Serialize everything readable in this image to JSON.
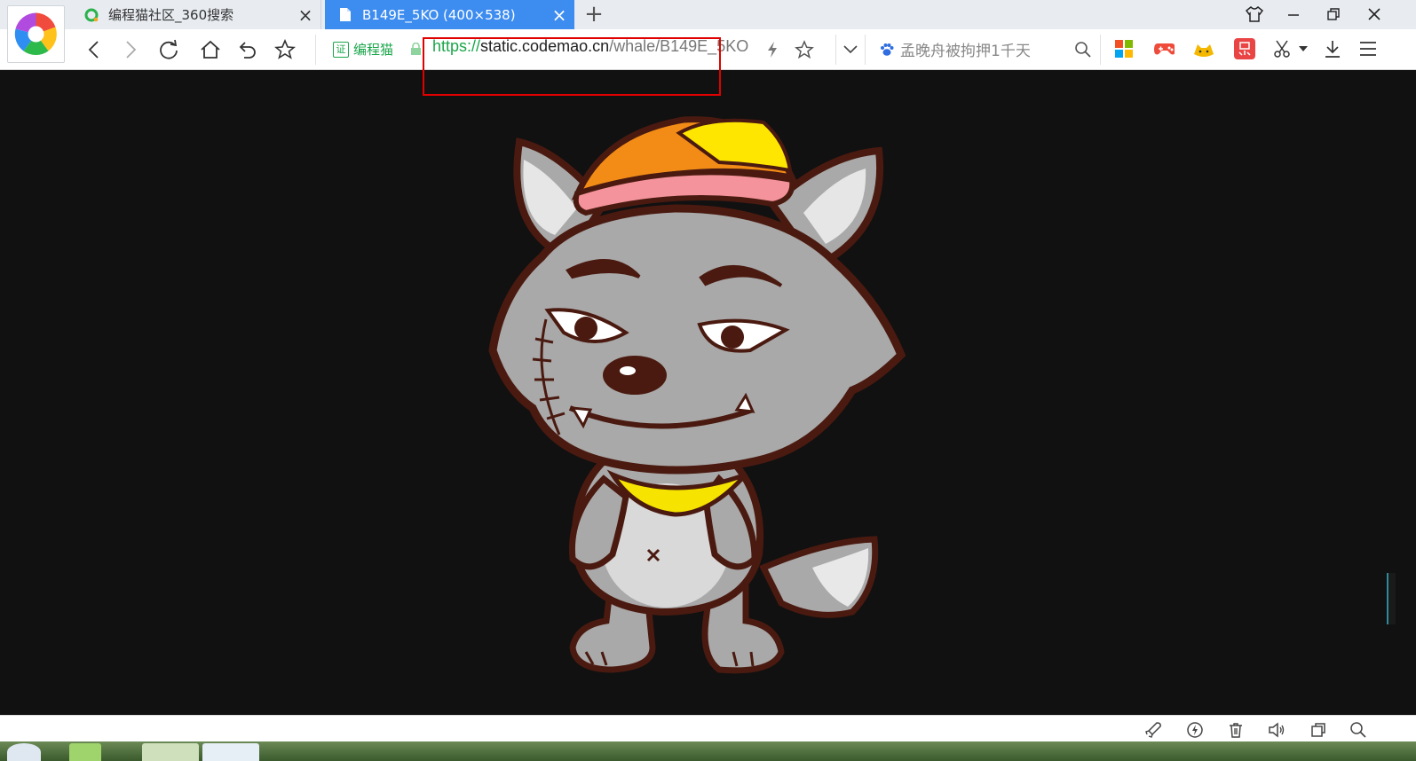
{
  "tabs": [
    {
      "title": "编程猫社区_360搜索",
      "active": false
    },
    {
      "title": "B149E_5KO (400×538)",
      "active": true
    }
  ],
  "toolbar": {
    "cert_label": "编程猫",
    "url": {
      "protocol": "https://",
      "host": "static.codemao.cn",
      "path": "/whale/B149E_5KO"
    },
    "hot_search": "孟晚舟被拘押1千天"
  },
  "colors": {
    "tab_active": "#3d8cf0",
    "secure_green": "#1aa64a",
    "highlight_box": "#e00000",
    "page_background": "#111111"
  },
  "image": {
    "subject": "grey-wolf-cartoon-icon"
  }
}
